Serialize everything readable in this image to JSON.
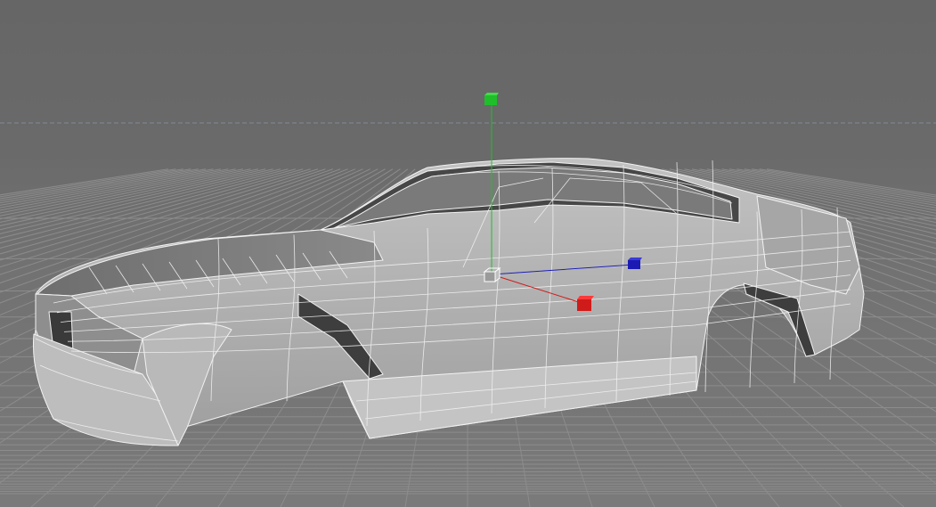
{
  "viewport": {
    "background": "#6b6b6b",
    "grid_color": "#8c8c8c",
    "horizon_line_color": "#7f8a95"
  },
  "model": {
    "wire_color": "#f2f2f2",
    "fill_light": "#b4b4b4",
    "fill_mid": "#999999",
    "fill_dark": "#3e3e3e"
  },
  "gizmo": {
    "x_axis_color": "#d01b1b",
    "y_axis_color": "#1fbf2a",
    "z_axis_color": "#1b1bb4",
    "pivot_color": "#ffffff",
    "icons": [
      "pivot-cube-icon",
      "x-axis-handle-icon",
      "y-axis-handle-icon",
      "z-axis-handle-icon"
    ]
  }
}
